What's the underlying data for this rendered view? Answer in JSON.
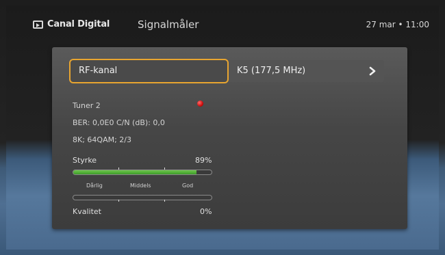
{
  "header": {
    "brand": "Canal Digital",
    "title": "Signalmåler",
    "datetime": "27 mar • 11:00"
  },
  "rf": {
    "label": "RF-kanal",
    "value": "K5 (177,5 MHz)"
  },
  "info": {
    "tuner": "Tuner 2",
    "ber_cn": "BER: 0,0E0  C/N (dB): 0,0",
    "mode": "8K; 64QAM; 2/3"
  },
  "strength": {
    "label": "Styrke",
    "value_text": "89%",
    "level": 0.89
  },
  "scale": {
    "bad": "Dårlig",
    "medium": "Middels",
    "good": "God"
  },
  "quality": {
    "label": "Kvalitet",
    "value_text": "0%",
    "level": 0.0
  },
  "colors": {
    "focus": "#e8a530",
    "bar_fill": "#4fb03a",
    "status_dot": "#d40000"
  },
  "icons": {
    "brand": "tv-play-icon",
    "next": "chevron-right-icon",
    "status": "red-dot-icon"
  }
}
